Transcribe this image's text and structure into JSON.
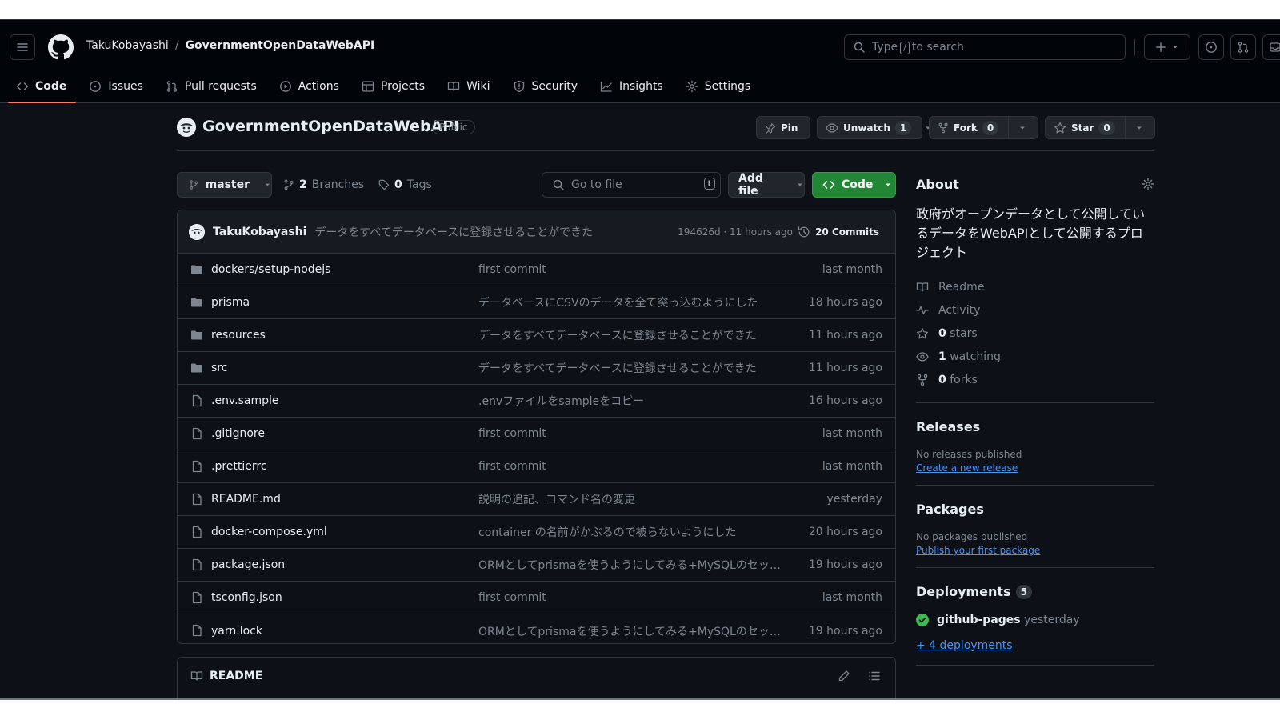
{
  "header": {
    "owner": "TakuKobayashi",
    "separator": "/",
    "repo": "GovernmentOpenDataWebAPI",
    "search_prefix": "Type",
    "search_key": "/",
    "search_suffix": "to search"
  },
  "tabs": [
    {
      "label": "Code",
      "icon": "code-icon",
      "active": true
    },
    {
      "label": "Issues",
      "icon": "issue-icon"
    },
    {
      "label": "Pull requests",
      "icon": "pull-request-icon"
    },
    {
      "label": "Actions",
      "icon": "play-icon"
    },
    {
      "label": "Projects",
      "icon": "table-icon"
    },
    {
      "label": "Wiki",
      "icon": "book-icon"
    },
    {
      "label": "Security",
      "icon": "shield-icon"
    },
    {
      "label": "Insights",
      "icon": "graph-icon"
    },
    {
      "label": "Settings",
      "icon": "gear-icon"
    }
  ],
  "repo": {
    "name": "GovernmentOpenDataWebAPI",
    "visibility": "Public",
    "pin_label": "Pin",
    "unwatch_label": "Unwatch",
    "watch_count": "1",
    "fork_label": "Fork",
    "fork_count": "0",
    "star_label": "Star",
    "star_count": "0"
  },
  "toolbar": {
    "branch": "master",
    "branches_count": "2",
    "branches_label": "Branches",
    "tags_count": "0",
    "tags_label": "Tags",
    "goto_placeholder": "Go to file",
    "goto_key": "t",
    "add_file": "Add file",
    "code": "Code"
  },
  "commit": {
    "author": "TakuKobayashi",
    "message": "データをすべてデータベースに登録させることができた",
    "hash_time": "194626d · 11 hours ago",
    "commits": "20 Commits"
  },
  "files": [
    {
      "type": "dir",
      "name": "dockers/setup-nodejs",
      "message": "first commit",
      "date": "last month"
    },
    {
      "type": "dir",
      "name": "prisma",
      "message": "データベースにCSVのデータを全て突っ込むようにした",
      "date": "18 hours ago"
    },
    {
      "type": "dir",
      "name": "resources",
      "message": "データをすべてデータベースに登録させることができた",
      "date": "11 hours ago"
    },
    {
      "type": "dir",
      "name": "src",
      "message": "データをすべてデータベースに登録させることができた",
      "date": "11 hours ago"
    },
    {
      "type": "file",
      "name": ".env.sample",
      "message": ".envファイルをsampleをコピー",
      "date": "16 hours ago"
    },
    {
      "type": "file",
      "name": ".gitignore",
      "message": "first commit",
      "date": "last month"
    },
    {
      "type": "file",
      "name": ".prettierrc",
      "message": "first commit",
      "date": "last month"
    },
    {
      "type": "file",
      "name": "README.md",
      "message": "説明の追記、コマンド名の変更",
      "date": "yesterday"
    },
    {
      "type": "file",
      "name": "docker-compose.yml",
      "message": "container の名前がかぶるので被らないようにした",
      "date": "20 hours ago"
    },
    {
      "type": "file",
      "name": "package.json",
      "message": "ORMとしてprismaを使うようにしてみる+MySQLのセッ…",
      "date": "19 hours ago"
    },
    {
      "type": "file",
      "name": "tsconfig.json",
      "message": "first commit",
      "date": "last month"
    },
    {
      "type": "file",
      "name": "yarn.lock",
      "message": "ORMとしてprismaを使うようにしてみる+MySQLのセッ…",
      "date": "19 hours ago"
    }
  ],
  "readme": {
    "label": "README"
  },
  "sidebar": {
    "about_title": "About",
    "description": "政府がオープンデータとして公開しているデータをWebAPIとして公開するプロジェクト",
    "links": [
      {
        "icon": "book-icon",
        "label": "Readme"
      },
      {
        "icon": "pulse-icon",
        "label": "Activity"
      },
      {
        "icon": "star-icon",
        "count": "0",
        "label": "stars"
      },
      {
        "icon": "eye-icon",
        "count": "1",
        "label": "watching"
      },
      {
        "icon": "fork-icon",
        "count": "0",
        "label": "forks"
      }
    ],
    "releases_title": "Releases",
    "releases_empty": "No releases published",
    "releases_link": "Create a new release",
    "packages_title": "Packages",
    "packages_empty": "No packages published",
    "packages_link": "Publish your first package",
    "deployments_title": "Deployments",
    "deployments_count": "5",
    "deployment_name": "github-pages",
    "deployment_time": "yesterday",
    "deployments_more": "+ 4 deployments"
  },
  "colors": {
    "accent": "#f78166",
    "link": "#4493f8",
    "primary_button": "#238636",
    "success": "#3fb950"
  }
}
